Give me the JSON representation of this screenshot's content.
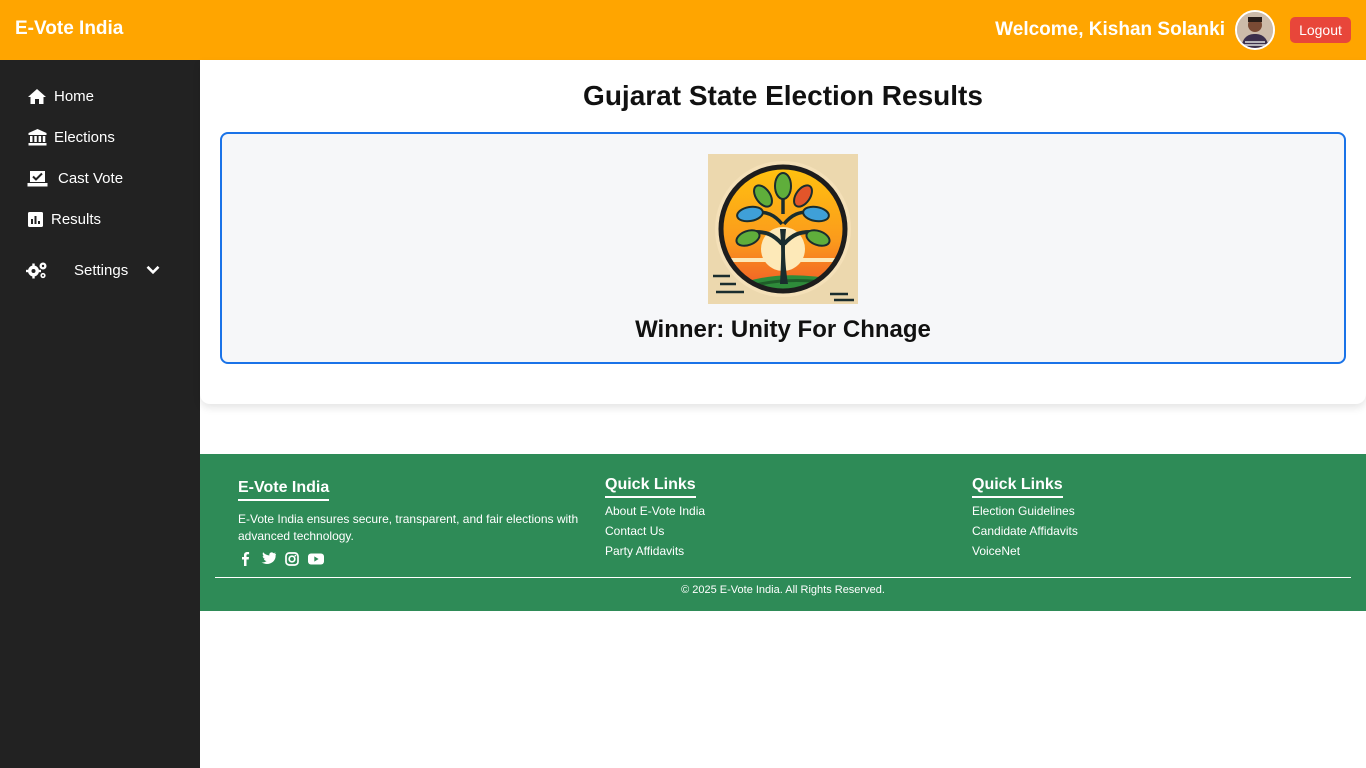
{
  "header": {
    "brand": "E-Vote India",
    "welcome": "Welcome, Kishan Solanki",
    "logout_label": "Logout",
    "bg_color": "#ffa500",
    "avatar_icon": "user-avatar"
  },
  "sidebar": {
    "items": [
      {
        "label": "Home",
        "icon": "home-icon"
      },
      {
        "label": "Elections",
        "icon": "bank-icon"
      },
      {
        "label": "Cast Vote",
        "icon": "vote-icon"
      },
      {
        "label": "Results",
        "icon": "chart-icon"
      },
      {
        "label": "Settings",
        "icon": "gears-icon"
      }
    ],
    "bg_color": "#222222"
  },
  "main": {
    "title": "Gujarat State Election Results",
    "winner_text": "Winner: Unity For Chnage",
    "box_border_color": "#1a73e8"
  },
  "footer": {
    "about_title": "E-Vote India",
    "about_text": "E-Vote India ensures secure, transparent, and fair elections with advanced technology.",
    "col2_title": "Quick Links",
    "col2_links": [
      "About E-Vote India",
      "Contact Us",
      "Party Affidavits"
    ],
    "col3_title": "Quick Links",
    "col3_links": [
      "Election Guidelines",
      "Candidate Affidavits",
      "VoiceNet"
    ],
    "socials": [
      "facebook-icon",
      "twitter-icon",
      "instagram-icon",
      "youtube-icon"
    ],
    "copyright": "© 2025 E-Vote India. All Rights Reserved.",
    "bg_color": "#2e8b57"
  }
}
